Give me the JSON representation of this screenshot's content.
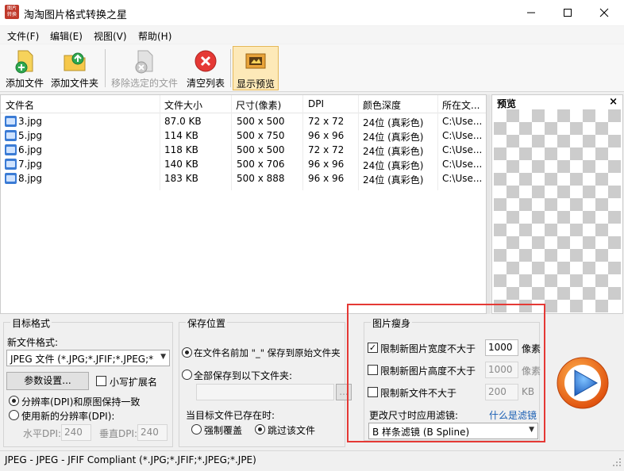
{
  "window": {
    "app_icon_text": "图片\n转换",
    "title": "淘淘图片格式转换之星",
    "min_label": "—",
    "max_label": "☐",
    "close_label": "✕"
  },
  "menu": [
    "文件(F)",
    "编辑(E)",
    "视图(V)",
    "帮助(H)"
  ],
  "toolbar": {
    "add_file": "添加文件",
    "add_folder": "添加文件夹",
    "remove_selected": "移除选定的文件",
    "clear_list": "清空列表",
    "show_preview": "显示预览"
  },
  "file_list": {
    "columns": [
      "文件名",
      "文件大小",
      "尺寸(像素)",
      "DPI",
      "颜色深度",
      "所在文..."
    ],
    "rows": [
      {
        "name": "3.jpg",
        "size": "87.0 KB",
        "dims": "500 x 500",
        "dpi": "72 x 72",
        "depth": "24位 (真彩色)",
        "path": "C:\\Use..."
      },
      {
        "name": "5.jpg",
        "size": "114 KB",
        "dims": "500 x 750",
        "dpi": "96 x 96",
        "depth": "24位 (真彩色)",
        "path": "C:\\Use..."
      },
      {
        "name": "6.jpg",
        "size": "118 KB",
        "dims": "500 x 500",
        "dpi": "72 x 72",
        "depth": "24位 (真彩色)",
        "path": "C:\\Use..."
      },
      {
        "name": "7.jpg",
        "size": "140 KB",
        "dims": "500 x 706",
        "dpi": "96 x 96",
        "depth": "24位 (真彩色)",
        "path": "C:\\Use..."
      },
      {
        "name": "8.jpg",
        "size": "183 KB",
        "dims": "500 x 888",
        "dpi": "96 x 96",
        "depth": "24位 (真彩色)",
        "path": "C:\\Use..."
      }
    ]
  },
  "preview": {
    "title": "预览",
    "close_label": "×"
  },
  "target_format": {
    "group_title": "目标格式",
    "new_format_label": "新文件格式:",
    "format_value": "JPEG 文件 (*.JPG;*.JFIF;*.JPEG;*",
    "params_button": "参数设置...",
    "lowercase_ext_label": "小写扩展名",
    "lowercase_ext_checked": false,
    "dpi_keep_label": "分辨率(DPI)和原图保持一致",
    "dpi_new_label": "使用新的分辨率(DPI):",
    "h_dpi_label": "水平DPI:",
    "h_dpi_value": "240",
    "v_dpi_label": "垂直DPI:",
    "v_dpi_value": "240"
  },
  "save_location": {
    "group_title": "保存位置",
    "option_prefix_label": "在文件名前加 \"_\" 保存到原始文件夹",
    "option_all_label": "全部保存到以下文件夹:",
    "folder_value": "",
    "browse_label": "...",
    "exists_label": "当目标文件已存在时:",
    "overwrite_label": "强制覆盖",
    "skip_label": "跳过该文件"
  },
  "resize": {
    "group_title": "图片瘦身",
    "limit_width_label": "限制新图片宽度不大于",
    "limit_width_checked": true,
    "width_value": "1000",
    "width_unit": "像素",
    "limit_height_label": "限制新图片高度不大于",
    "limit_height_checked": false,
    "height_value": "1000",
    "height_unit": "像素",
    "limit_size_label": "限制新文件不大于",
    "limit_size_checked": false,
    "size_value": "200",
    "size_unit": "KB",
    "filter_label": "更改尺寸时应用滤镜:",
    "filter_link": "什么是滤镜",
    "filter_value": "B 样条滤镜 (B Spline)"
  },
  "status": {
    "text": "JPEG - JPEG - JFIF Compliant (*.JPG;*.JFIF;*.JPEG;*.JPE)"
  },
  "colors": {
    "accent_red": "#e53935",
    "start_button_orange": "#f07b1f",
    "start_button_blue": "#2e7cd6",
    "link_blue": "#1a5fb4"
  },
  "icons": {
    "add_file": "add-file-icon",
    "add_folder": "add-folder-icon",
    "remove": "remove-file-icon",
    "clear": "clear-list-icon",
    "preview": "preview-icon",
    "start": "start-convert-icon"
  }
}
